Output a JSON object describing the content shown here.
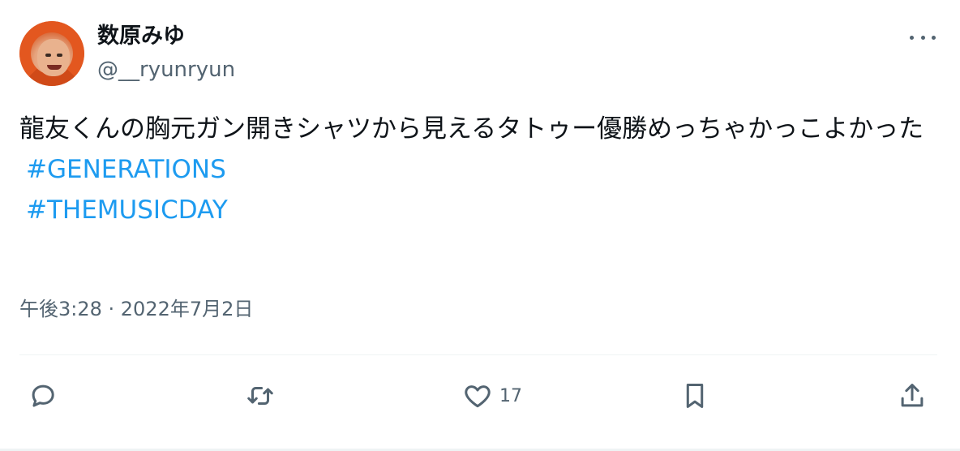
{
  "author": {
    "display_name": "数原みゆ",
    "handle": "@__ryunryun"
  },
  "tweet": {
    "text_line1": "龍友くんの胸元ガン開きシャツから見えるタトゥー優勝めっちゃかっこよかった",
    "hashtags": [
      "#GENERATIONS",
      "#THEMUSICDAY"
    ],
    "timestamp": "午後3:28 · 2022年7月2日"
  },
  "actions": {
    "reply_icon": "reply-icon",
    "retweet_icon": "retweet-icon",
    "like_icon": "heart-icon",
    "like_count": "17",
    "bookmark_icon": "bookmark-icon",
    "share_icon": "share-icon"
  },
  "colors": {
    "text": "#0f1419",
    "secondary": "#536471",
    "link": "#1d9bf0",
    "divider": "#eff3f4"
  }
}
